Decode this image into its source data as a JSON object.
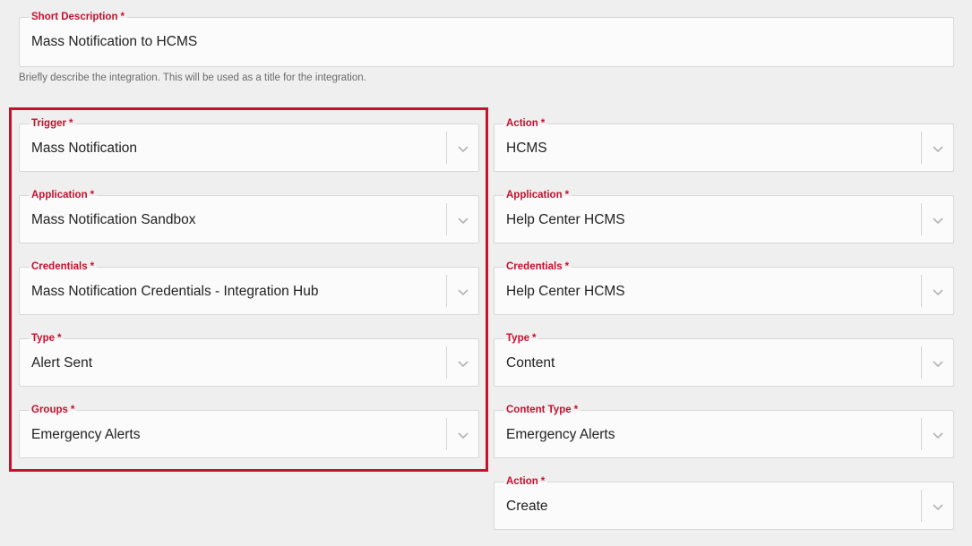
{
  "short_description": {
    "label": "Short Description",
    "required_mark": "*",
    "value": "Mass Notification to HCMS",
    "helper": "Briefly describe the integration. This will be used as a title for the integration."
  },
  "trigger_column": {
    "trigger": {
      "label": "Trigger",
      "required_mark": "*",
      "value": "Mass Notification"
    },
    "application": {
      "label": "Application",
      "required_mark": "*",
      "value": "Mass Notification Sandbox"
    },
    "credentials": {
      "label": "Credentials",
      "required_mark": "*",
      "value": "Mass Notification Credentials - Integration Hub"
    },
    "type": {
      "label": "Type",
      "required_mark": "*",
      "value": "Alert Sent"
    },
    "groups": {
      "label": "Groups",
      "required_mark": "*",
      "value": "Emergency Alerts"
    }
  },
  "action_column": {
    "action": {
      "label": "Action",
      "required_mark": "*",
      "value": "HCMS"
    },
    "application": {
      "label": "Application",
      "required_mark": "*",
      "value": "Help Center HCMS"
    },
    "credentials": {
      "label": "Credentials",
      "required_mark": "*",
      "value": "Help Center HCMS"
    },
    "type": {
      "label": "Type",
      "required_mark": "*",
      "value": "Content"
    },
    "content_type": {
      "label": "Content Type",
      "required_mark": "*",
      "value": "Emergency Alerts"
    },
    "operation": {
      "label": "Action",
      "required_mark": "*",
      "value": "Create"
    }
  },
  "colors": {
    "accent": "#c4122f",
    "background": "#efefef",
    "field_background": "#fbfbfb"
  },
  "icons": {
    "dropdown": "chevron-down-icon"
  }
}
